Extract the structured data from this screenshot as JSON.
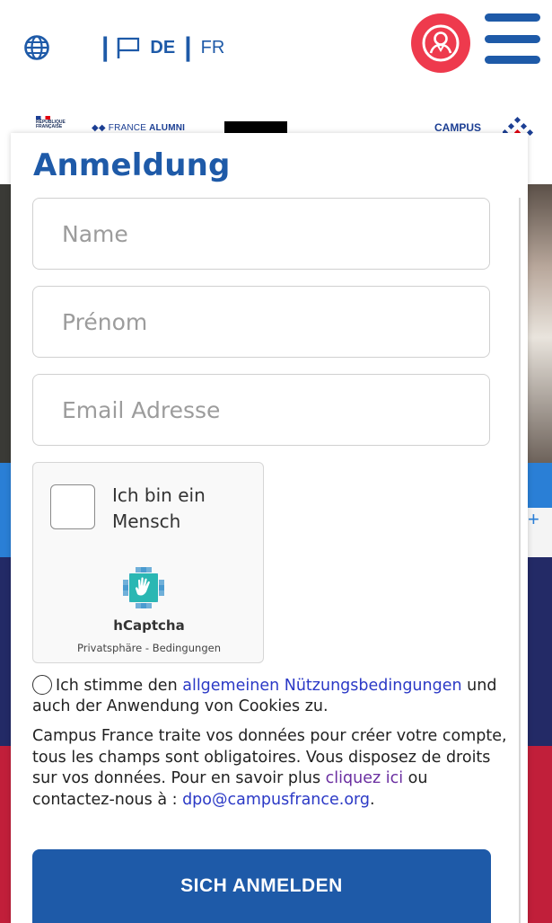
{
  "header": {
    "lang_separator": "|",
    "lang_de": "DE",
    "lang_fr": "FR",
    "icons": [
      "globe-icon",
      "flag-icon",
      "user-icon",
      "hamburger-menu-icon"
    ],
    "colors": {
      "brand_blue": "#1e5aa8",
      "avatar_red": "#ee3a4d"
    }
  },
  "background": {
    "republique_lines": [
      "RÉPUBLIQUE",
      "FRANÇAISE"
    ],
    "france_alumni_prefix": "FRANCE",
    "france_alumni_suffix": "ALUMNI",
    "campus_label": "CAMPUS",
    "plus_sign": "+"
  },
  "modal": {
    "title": "Anmeldung",
    "fields": {
      "name_placeholder": "Name",
      "prenom_placeholder": "Prénom",
      "email_placeholder": "Email Adresse"
    },
    "captcha": {
      "label": "Ich bin ein Mensch",
      "brand": "hCaptcha",
      "privacy": "Privatsphäre",
      "separator": "-",
      "terms": "Bedingungen"
    },
    "terms": {
      "before": "Ich stimme den ",
      "link": "allgemeinen Nützungsbedingungen",
      "after": " und auch der Anwendung von Cookies zu."
    },
    "info": {
      "text": "Campus France traite vos données pour créer votre compte, tous les champs sont obligatoires. Vous disposez de droits sur vos données. Pour en savoir plus ",
      "link_here": "cliquez ici",
      "middle": " ou contactez-nous à : ",
      "email": "dpo@campusfrance.org",
      "end": "."
    },
    "submit_label": "SICH ANMELDEN"
  }
}
